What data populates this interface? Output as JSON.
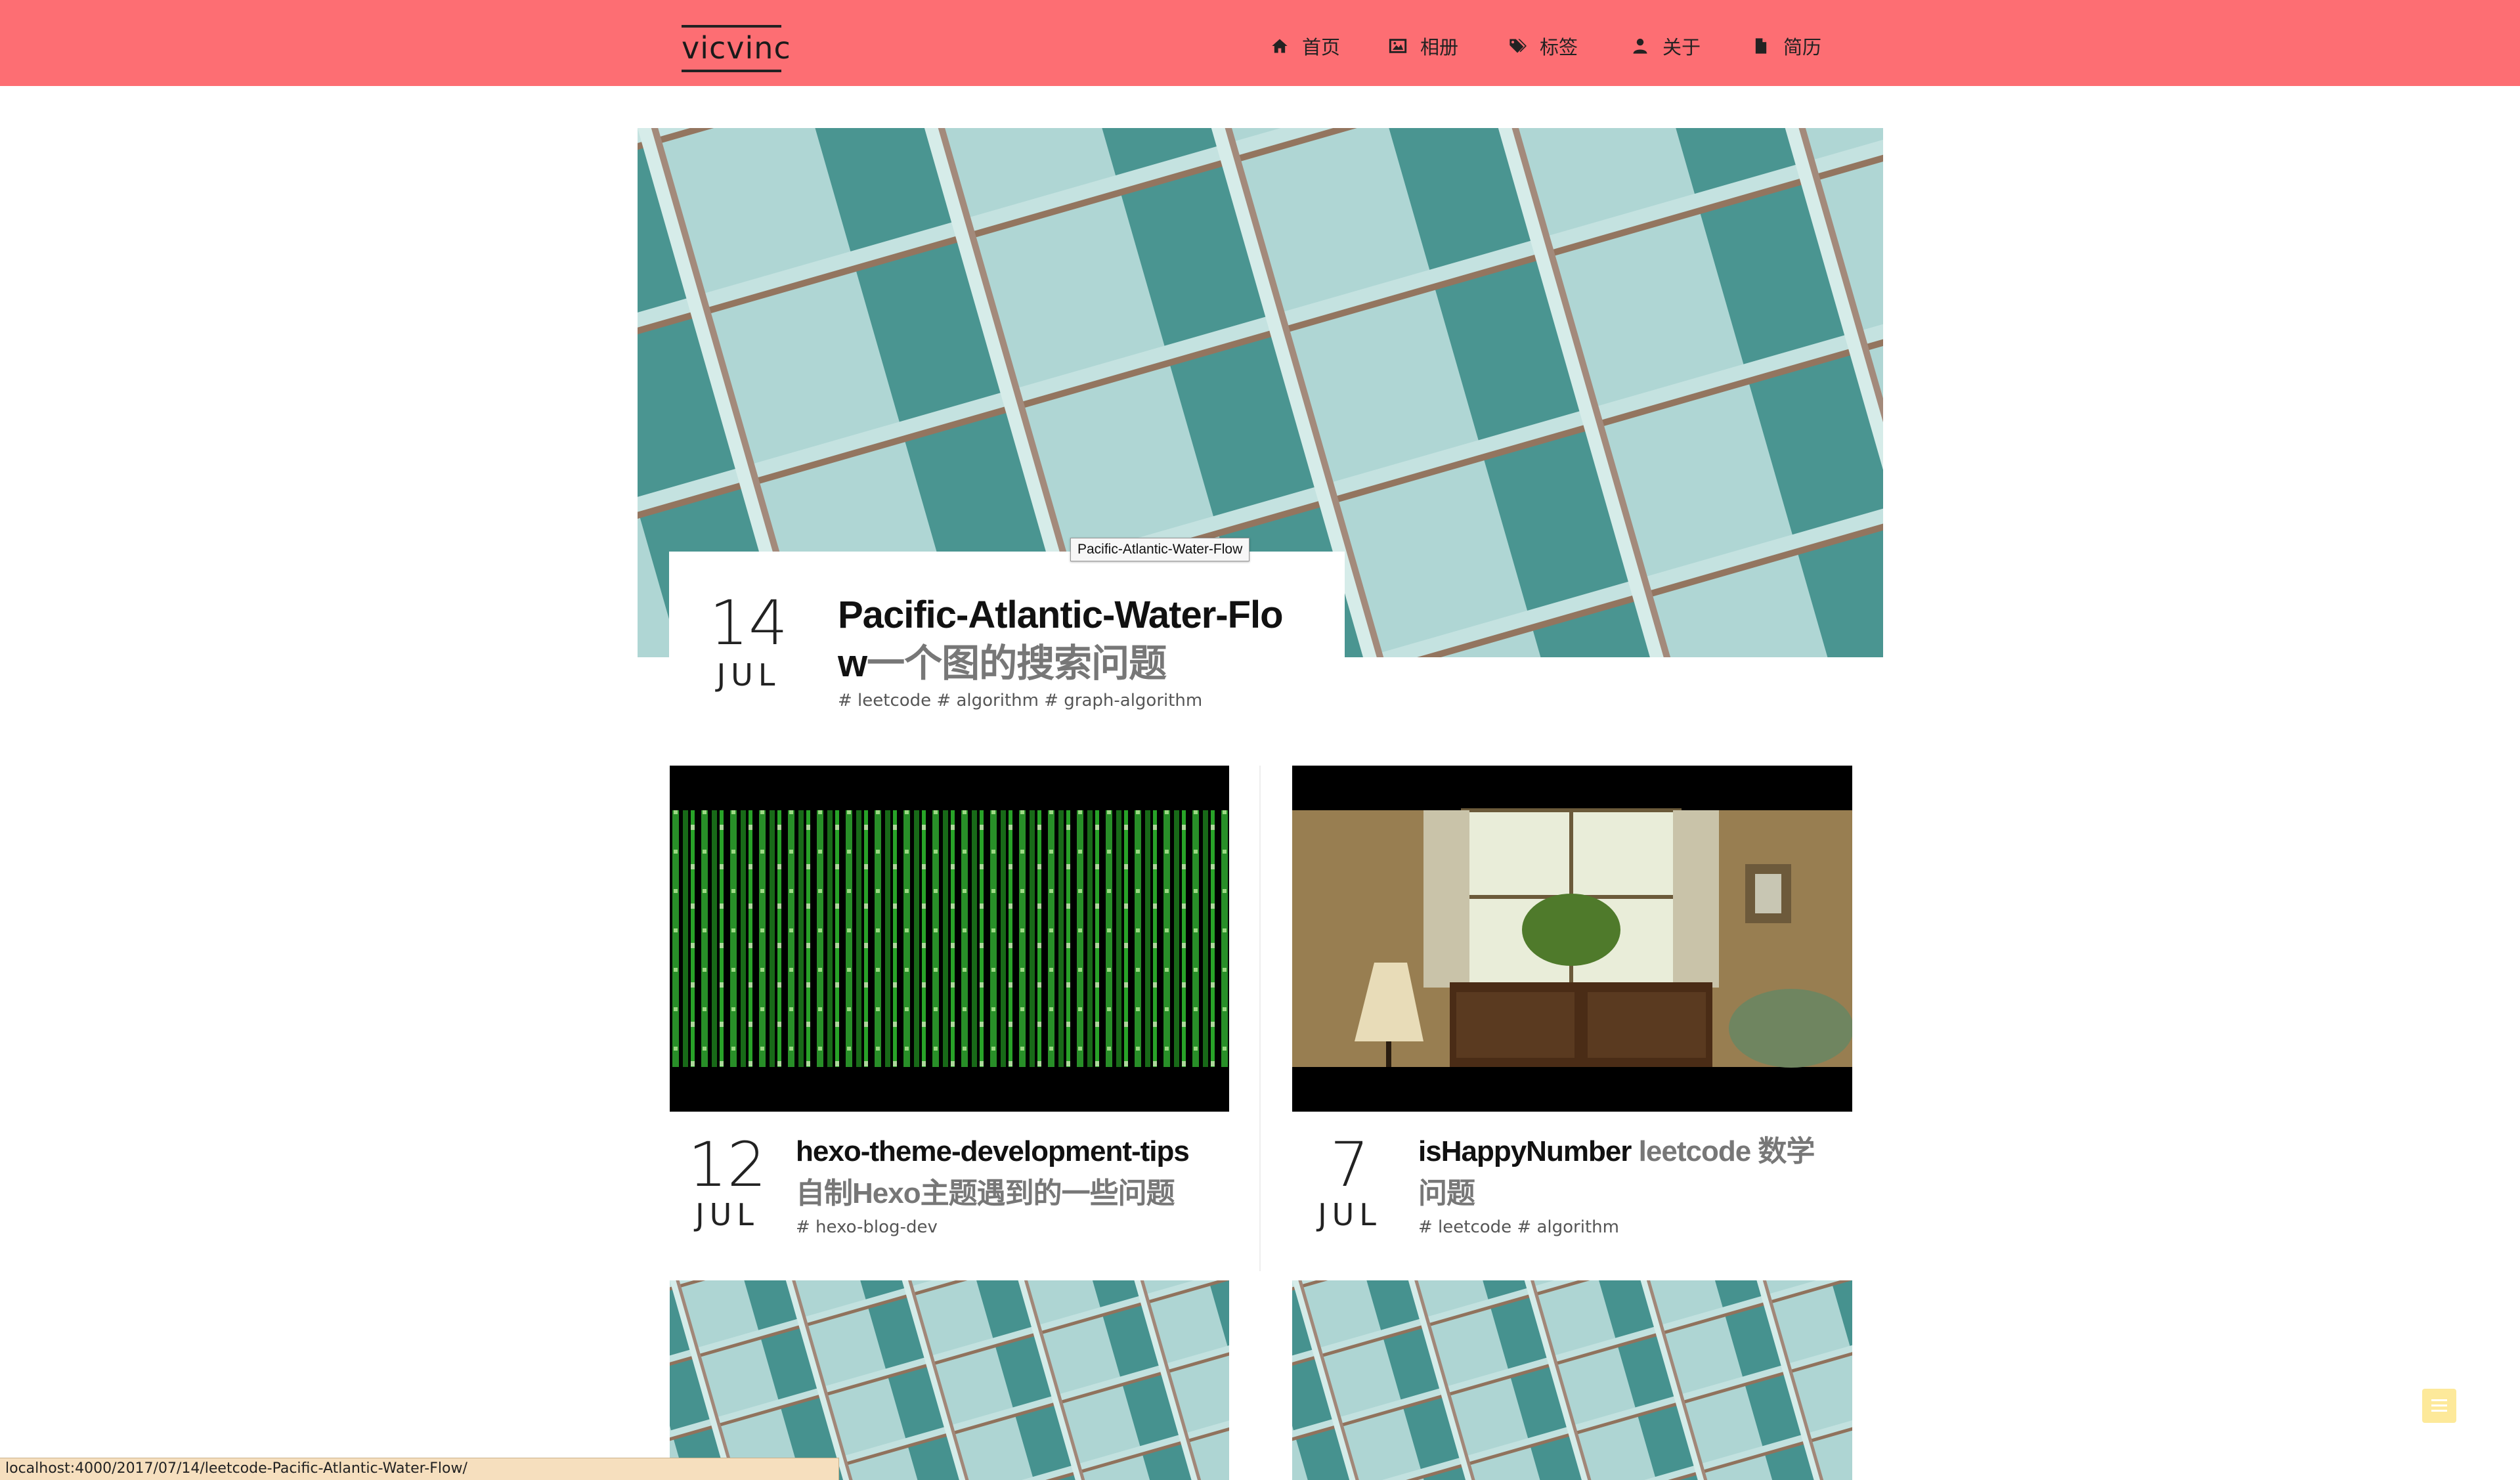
{
  "site": {
    "logo": "vicvinc"
  },
  "nav": [
    {
      "label": "首页",
      "icon": "home-icon"
    },
    {
      "label": "相册",
      "icon": "picture-icon"
    },
    {
      "label": "标签",
      "icon": "tags-icon"
    },
    {
      "label": "关于",
      "icon": "user-icon"
    },
    {
      "label": "简历",
      "icon": "file-icon"
    }
  ],
  "featured": {
    "day": "14",
    "month": "JUL",
    "title_line1": "Pacific-Atlantic-Water-Flo",
    "title_line2_main": "w",
    "title_line2_sub": "一个图的搜索问题",
    "tags": "# leetcode # algorithm # graph-algorithm",
    "tooltip": "Pacific-Atlantic-Water-Flow",
    "image": "teal-grid-photo"
  },
  "posts": [
    {
      "day": "12",
      "month": "JUL",
      "title_main": "hexo-theme-development-tips",
      "title_sub": "自制Hexo主题遇到的一些问题",
      "tags": "# hexo-blog-dev",
      "image": "matrix-code-photo"
    },
    {
      "day": "7",
      "month": "JUL",
      "title_main": "isHappyNumber",
      "title_sub1": "leetcode 数学",
      "title_sub2": "问题",
      "tags": "# leetcode # algorithm",
      "image": "window-room-photo"
    },
    {
      "image": "teal-grid-photo"
    },
    {
      "image": "teal-grid-photo"
    }
  ],
  "statusbar": {
    "url": "localhost:4000/2017/07/14/leetcode-Pacific-Atlantic-Water-Flow/"
  },
  "colors": {
    "header": "#fd6e73",
    "fab": "#fde99a"
  }
}
